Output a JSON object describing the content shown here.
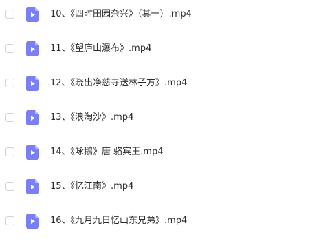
{
  "files": [
    {
      "name": "10、《四时田园杂兴》（其一）.mp4",
      "icon": "video-file-icon"
    },
    {
      "name": "11、《望庐山瀑布》.mp4",
      "icon": "video-file-icon"
    },
    {
      "name": "12、《晓出净慈寺送林子方》.mp4",
      "icon": "video-file-icon"
    },
    {
      "name": "13、《浪淘沙》.mp4",
      "icon": "video-file-icon"
    },
    {
      "name": "14、《咏鹅》唐 骆宾王.mp4",
      "icon": "video-file-icon"
    },
    {
      "name": "15、《忆江南》.mp4",
      "icon": "video-file-icon"
    },
    {
      "name": "16、《九月九日忆山东兄弟》.mp4",
      "icon": "video-file-icon"
    }
  ],
  "colors": {
    "icon_bg": "#7b7ff5",
    "icon_fold": "#b8bbfa",
    "text": "#2b2b2b",
    "checkbox_border": "#cfd3db"
  }
}
